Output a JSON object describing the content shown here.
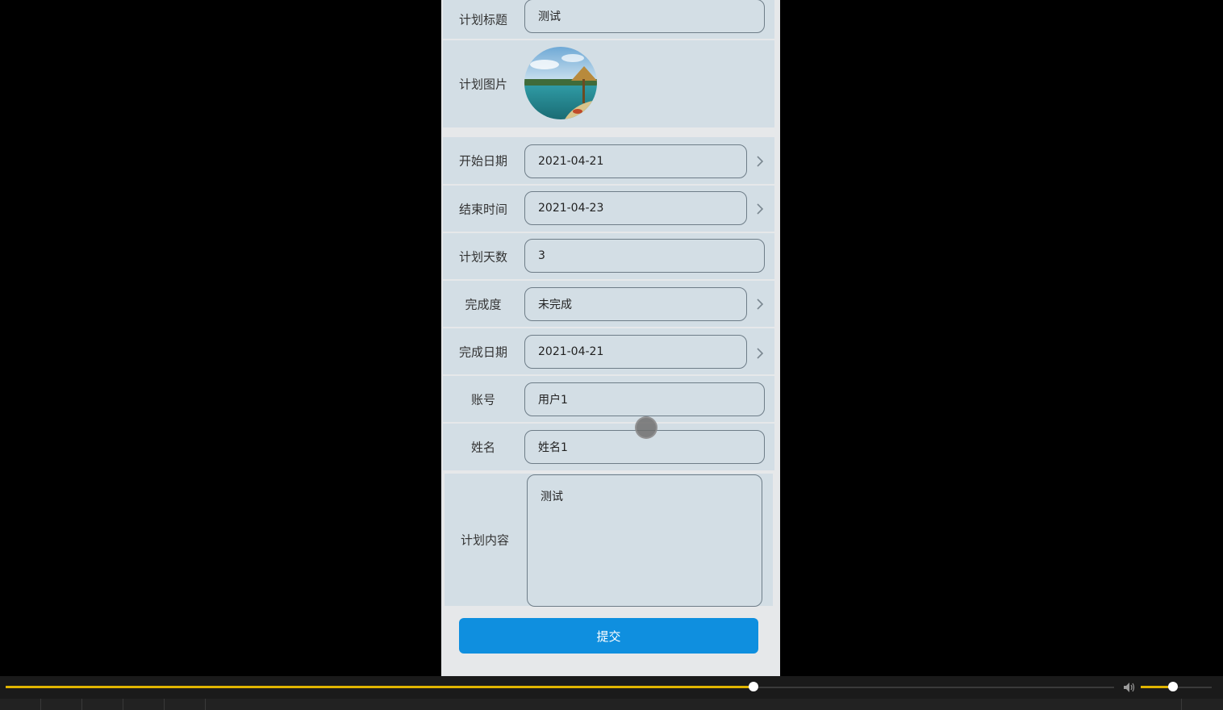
{
  "form": {
    "title": {
      "label": "计划标题",
      "value": "测试"
    },
    "image": {
      "label": "计划图片"
    },
    "start_date": {
      "label": "开始日期",
      "value": "2021-04-21"
    },
    "end_time": {
      "label": "结束时间",
      "value": "2021-04-23"
    },
    "plan_days": {
      "label": "计划天数",
      "value": "3"
    },
    "completion": {
      "label": "完成度",
      "value": "未完成"
    },
    "complete_date": {
      "label": "完成日期",
      "value": "2021-04-21"
    },
    "account": {
      "label": "账号",
      "value": "用户1"
    },
    "name": {
      "label": "姓名",
      "value": "姓名1"
    },
    "content": {
      "label": "计划内容",
      "value": "测试"
    },
    "submit_label": "提交"
  },
  "player": {
    "progress": 0.675,
    "volume": 0.45,
    "accent_color": "#e0b400"
  }
}
